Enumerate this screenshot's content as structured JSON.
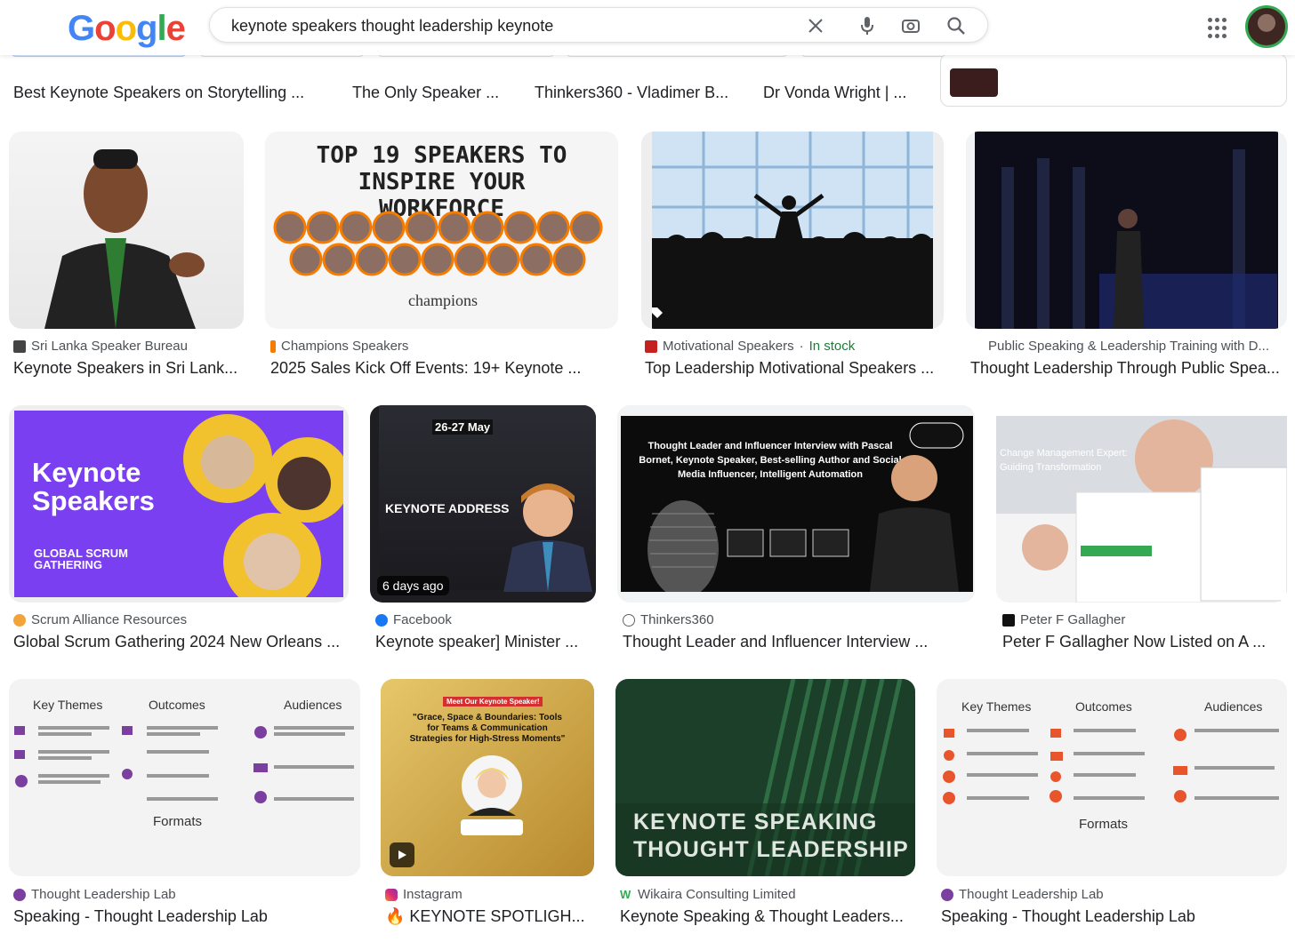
{
  "search": {
    "query": "keynote speakers thought leadership keynote"
  },
  "icons": {
    "clear": "close-icon",
    "voice": "mic-icon",
    "lens": "camera-icon",
    "search": "search-icon",
    "apps": "apps-grid-icon"
  },
  "previous_row": [
    "Best Keynote Speakers on Storytelling ...",
    "The Only Speaker ...",
    "Thinkers360 - Vladimer B...",
    "Dr Vonda Wright | ..."
  ],
  "results": [
    {
      "source": "Sri Lanka Speaker Bureau",
      "title": "Keynote Speakers in Sri Lank..."
    },
    {
      "source": "Champions Speakers",
      "title": "2025 Sales Kick Off Events: 19+ Keynote ...",
      "overlay_heading": "TOP 19 SPEAKERS TO INSPIRE YOUR WORKFORCE",
      "overlay_brand": "champions"
    },
    {
      "source": "Motivational Speakers",
      "separator": "·",
      "stock": "In stock",
      "title": "Top Leadership Motivational Speakers ..."
    },
    {
      "source": "Public Speaking & Leadership Training with D...",
      "title": "Thought Leadership Through Public Spea..."
    },
    {
      "source": "Scrum Alliance Resources",
      "title": "Global Scrum Gathering 2024 New Orleans ...",
      "overlay_heading": "Keynote Speakers",
      "overlay_sub": "GLOBAL SCRUM GATHERING"
    },
    {
      "source": "Facebook",
      "title": "Keynote speaker] Minister ...",
      "badge": "6 days ago",
      "overlay_heading": "KEYNOTE ADDRESS",
      "overlay_date": "26-27 May"
    },
    {
      "source": "Thinkers360",
      "title": "Thought Leader and Influencer Interview ...",
      "overlay_heading": "Thought Leader and Influencer Interview with Pascal Bornet, Keynote Speaker, Best-selling Author and Social Media Influencer, Intelligent Automation"
    },
    {
      "source": "Peter F Gallagher",
      "title": "Peter F Gallagher Now Listed on A ...",
      "overlay_heading": "Change Management Expert: Guiding Transformation"
    },
    {
      "source": "Thought Leadership Lab",
      "title": "Speaking - Thought Leadership Lab",
      "overlay_cols": [
        "Key Themes",
        "Outcomes",
        "Audiences"
      ],
      "overlay_footer": "Formats"
    },
    {
      "source": "Instagram",
      "title": "🔥 KEYNOTE SPOTLIGH...",
      "overlay_heading": "\"Grace, Space & Boundaries: Tools for Teams & Communication Strategies for High-Stress Moments\"",
      "overlay_tag": "Meet Our Keynote Speaker!"
    },
    {
      "source": "Wikaira Consulting Limited",
      "title": "Keynote Speaking & Thought Leaders...",
      "overlay_heading": "KEYNOTE SPEAKING THOUGHT LEADERSHIP"
    },
    {
      "source": "Thought Leadership Lab",
      "title": "Speaking - Thought Leadership Lab",
      "overlay_cols": [
        "Key Themes",
        "Outcomes",
        "Audiences"
      ],
      "overlay_footer": "Formats"
    }
  ],
  "colors": {
    "in_stock": "#188038",
    "google_blue": "#4285f4"
  }
}
